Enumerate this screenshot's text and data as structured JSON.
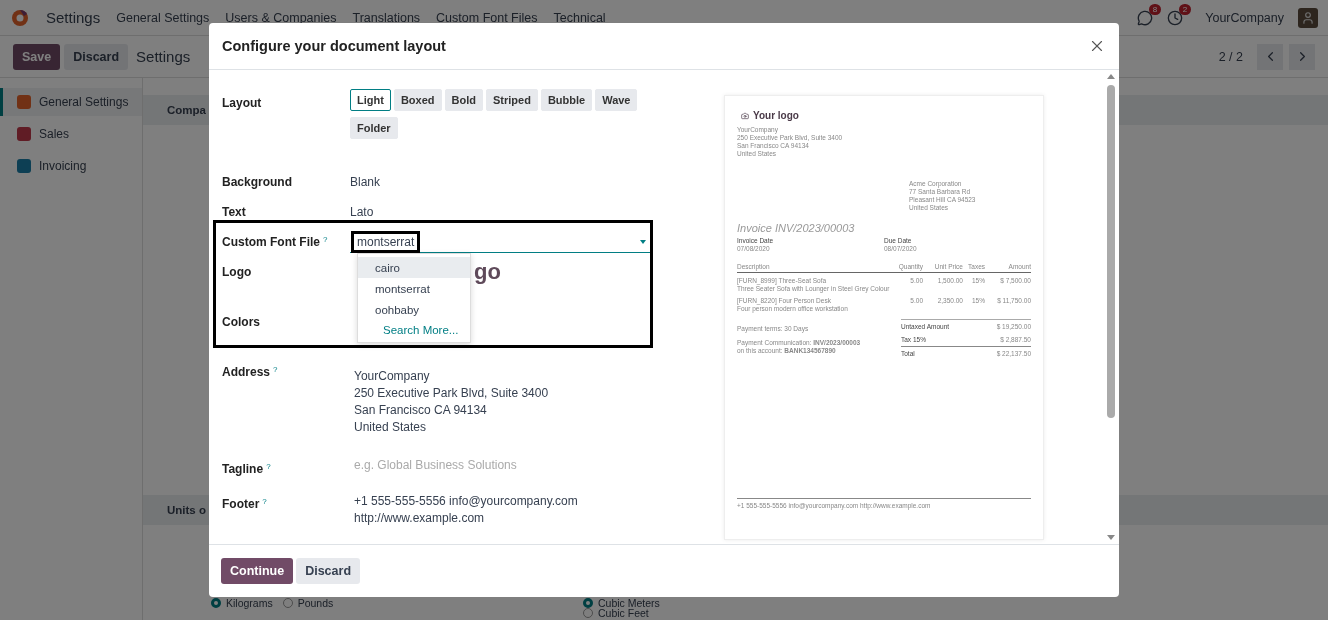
{
  "navbar": {
    "app_name": "Settings",
    "menu": [
      "General Settings",
      "Users & Companies",
      "Translations",
      "Custom Font Files",
      "Technical"
    ],
    "messages_badge": "8",
    "activities_badge": "2",
    "company": "YourCompany"
  },
  "control_panel": {
    "save": "Save",
    "discard": "Discard",
    "breadcrumb": "Settings",
    "pager": "2 / 2"
  },
  "sidebar": {
    "items": [
      {
        "label": "General Settings",
        "selected": true
      },
      {
        "label": "Sales",
        "selected": false
      },
      {
        "label": "Invoicing",
        "selected": false
      }
    ]
  },
  "content": {
    "sections": [
      "Compa",
      "Units o"
    ],
    "weight_options": [
      {
        "label": "Kilograms",
        "selected": true
      },
      {
        "label": "Pounds",
        "selected": false
      }
    ],
    "volume_options": [
      {
        "label": "Cubic Meters",
        "selected": true
      },
      {
        "label": "Cubic Feet",
        "selected": false
      }
    ]
  },
  "dialog": {
    "title": "Configure your document layout",
    "layout": {
      "label": "Layout",
      "options": [
        {
          "label": "Light",
          "selected": true
        },
        {
          "label": "Boxed",
          "selected": false
        },
        {
          "label": "Bold",
          "selected": false
        },
        {
          "label": "Striped",
          "selected": false
        },
        {
          "label": "Bubble",
          "selected": false
        },
        {
          "label": "Wave",
          "selected": false
        },
        {
          "label": "Folder",
          "selected": false
        }
      ]
    },
    "background": {
      "label": "Background",
      "value": "Blank"
    },
    "text": {
      "label": "Text",
      "value": "Lato"
    },
    "custom_font_file": {
      "label": "Custom Font File",
      "help": "?",
      "value": "montserrat",
      "options": [
        {
          "label": "cairo",
          "highlighted": true
        },
        {
          "label": "montserrat",
          "highlighted": false
        },
        {
          "label": "oohbaby",
          "highlighted": false
        }
      ],
      "search_more": "Search More..."
    },
    "logo": {
      "label": "Logo",
      "visible_text": "go"
    },
    "colors": {
      "label": "Colors"
    },
    "address": {
      "label": "Address",
      "help": "?",
      "lines": [
        "YourCompany",
        "250 Executive Park Blvd, Suite 3400",
        "San Francisco CA 94134",
        "United States"
      ]
    },
    "tagline": {
      "label": "Tagline",
      "help": "?",
      "placeholder": "e.g. Global Business Solutions"
    },
    "footer": {
      "label": "Footer",
      "help": "?",
      "lines": [
        "+1 555-555-5556 info@yourcompany.com",
        "http://www.example.com"
      ]
    },
    "continue": "Continue",
    "discard": "Discard",
    "preview": {
      "logo": "Your logo",
      "company_lines": [
        "YourCompany",
        "250 Executive Park Blvd, Suite 3400",
        "San Francisco CA 94134",
        "United States"
      ],
      "customer_lines": [
        "Acme Corporation",
        "77 Santa Barbara Rd",
        "Pleasant Hill CA 94523",
        "United States"
      ],
      "title": "Invoice INV/2023/00003",
      "dates": [
        {
          "label": "Invoice Date",
          "value": "07/08/2020"
        },
        {
          "label": "Due Date",
          "value": "08/07/2020"
        }
      ],
      "columns": [
        "Description",
        "Quantity",
        "Unit Price",
        "Taxes",
        "Amount"
      ],
      "rows": [
        {
          "name": "[FURN_8999] Three-Seat Sofa",
          "description": "Three Seater Sofa with Lounger in Steel Grey Colour",
          "quantity": "5.00",
          "unit_price": "1,500.00",
          "taxes": "15%",
          "amount": "$ 7,500.00"
        },
        {
          "name": "[FURN_8220] Four Person Desk",
          "description": "Four person modern office workstation",
          "quantity": "5.00",
          "unit_price": "2,350.00",
          "taxes": "15%",
          "amount": "$ 11,750.00"
        }
      ],
      "payment_terms": "Payment terms: 30 Days",
      "payment_communication": "Payment Communication: **INV/2023/00003**",
      "account": "on this account: **BANK134567890**",
      "totals": [
        {
          "label": "Untaxed Amount",
          "value": "$ 19,250.00"
        },
        {
          "label": "Tax 15%",
          "value": "$ 2,887.50"
        },
        {
          "label": "Total",
          "value": "$ 22,137.50"
        }
      ],
      "footer": "+1 555-555-5556 info@yourcompany.com http://www.example.com"
    }
  }
}
